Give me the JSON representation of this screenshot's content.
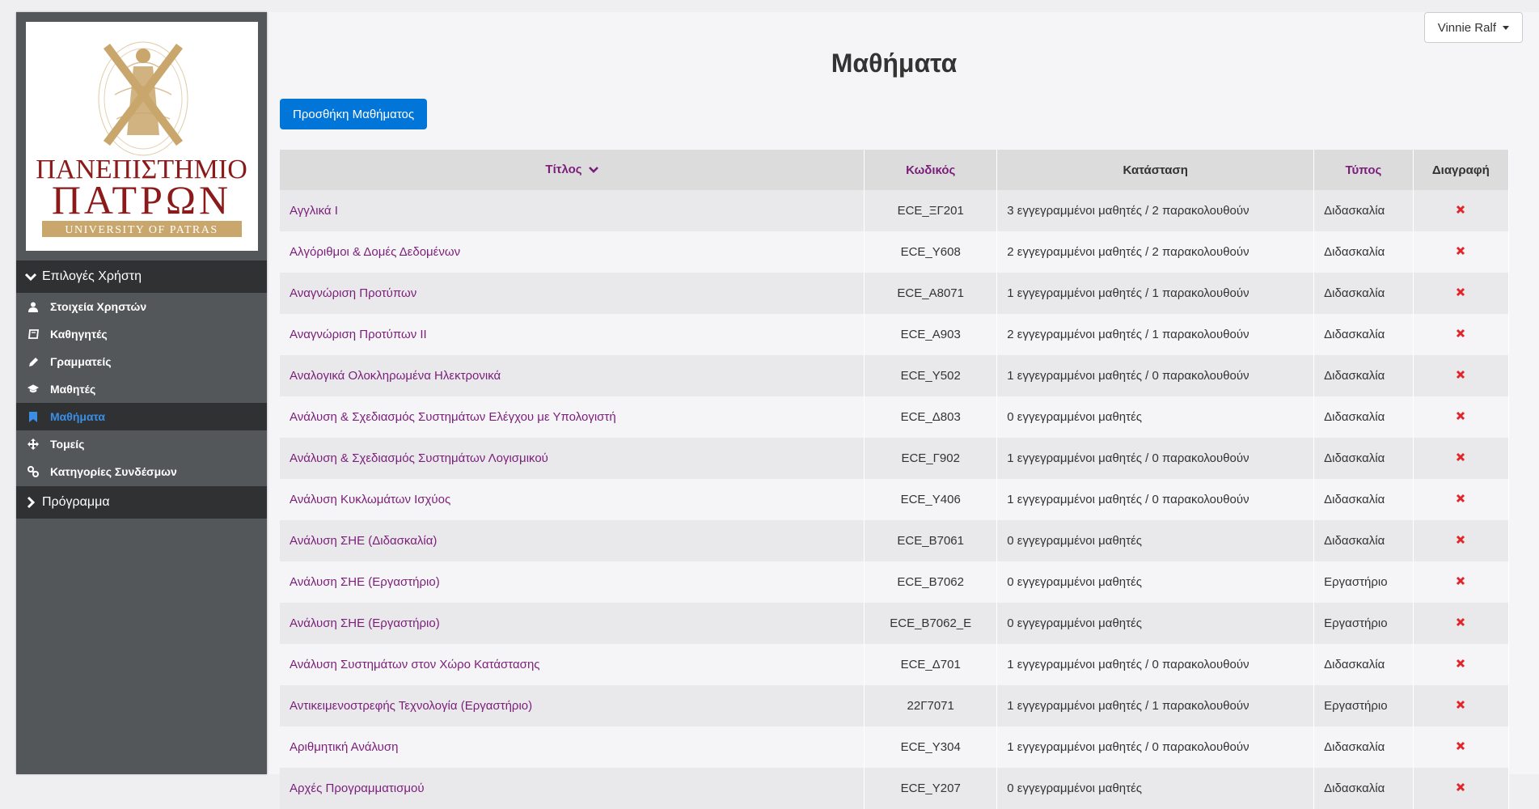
{
  "user": {
    "name": "Vinnie Ralf"
  },
  "logo": {
    "line1": "ΠΑΝΕΠΙΣΤΗΜΙΟ",
    "line2": "ΠΑΤΡΩΝ",
    "line3": "UNIVERSITY OF PATRAS",
    "brand_color": "#8b1a1a",
    "gold_color": "#c9a66b"
  },
  "sidebar": {
    "section1": "Επιλογές Χρήστη",
    "items": [
      {
        "label": "Στοιχεία Χρηστών",
        "icon": "user-icon"
      },
      {
        "label": "Καθηγητές",
        "icon": "book-icon"
      },
      {
        "label": "Γραμματείς",
        "icon": "pencil-icon"
      },
      {
        "label": "Μαθητές",
        "icon": "graduation-cap-icon"
      },
      {
        "label": "Μαθήματα",
        "icon": "bookmark-icon",
        "active": true
      },
      {
        "label": "Τομείς",
        "icon": "move-icon"
      },
      {
        "label": "Κατηγορίες Συνδέσμων",
        "icon": "link-icon"
      }
    ],
    "section2": "Πρόγραμμα"
  },
  "page": {
    "title": "Μαθήματα",
    "add_button": "Προσθήκη Μαθήματος"
  },
  "table": {
    "headers": {
      "title": "Τίτλος",
      "code": "Κωδικός",
      "status": "Κατάσταση",
      "type": "Τύπος",
      "delete": "Διαγραφή"
    },
    "rows": [
      {
        "title": "Αγγλικά Ι",
        "code": "ECE_ΞΓ201",
        "status": "3 εγγεγραμμένοι μαθητές / 2 παρακολουθούν",
        "type": "Διδασκαλία"
      },
      {
        "title": "Αλγόριθμοι & Δομές Δεδομένων",
        "code": "ECE_Υ608",
        "status": "2 εγγεγραμμένοι μαθητές / 2 παρακολουθούν",
        "type": "Διδασκαλία"
      },
      {
        "title": "Αναγνώριση Προτύπων",
        "code": "ECE_Α8071",
        "status": "1 εγγεγραμμένοι μαθητές / 1 παρακολουθούν",
        "type": "Διδασκαλία"
      },
      {
        "title": "Αναγνώριση Προτύπων ΙΙ",
        "code": "ECE_Α903",
        "status": "2 εγγεγραμμένοι μαθητές / 1 παρακολουθούν",
        "type": "Διδασκαλία"
      },
      {
        "title": "Αναλογικά Ολοκληρωμένα Ηλεκτρονικά",
        "code": "ECE_Υ502",
        "status": "1 εγγεγραμμένοι μαθητές / 0 παρακολουθούν",
        "type": "Διδασκαλία"
      },
      {
        "title": "Ανάλυση & Σχεδιασμός Συστημάτων Ελέγχου με Υπολογιστή",
        "code": "ECE_Δ803",
        "status": "0 εγγεγραμμένοι μαθητές",
        "type": "Διδασκαλία"
      },
      {
        "title": "Ανάλυση & Σχεδιασμός Συστημάτων Λογισμικού",
        "code": "ECE_Γ902",
        "status": "1 εγγεγραμμένοι μαθητές / 0 παρακολουθούν",
        "type": "Διδασκαλία"
      },
      {
        "title": "Ανάλυση Κυκλωμάτων Ισχύος",
        "code": "ECE_Υ406",
        "status": "1 εγγεγραμμένοι μαθητές / 0 παρακολουθούν",
        "type": "Διδασκαλία"
      },
      {
        "title": "Ανάλυση ΣΗΕ (Διδασκαλία)",
        "code": "ECE_Β7061",
        "status": "0 εγγεγραμμένοι μαθητές",
        "type": "Διδασκαλία"
      },
      {
        "title": "Ανάλυση ΣΗΕ (Εργαστήριο)",
        "code": "ECE_Β7062",
        "status": "0 εγγεγραμμένοι μαθητές",
        "type": "Εργαστήριο"
      },
      {
        "title": "Ανάλυση ΣΗΕ (Εργαστήριο)",
        "code": "ECE_Β7062_Ε",
        "status": "0 εγγεγραμμένοι μαθητές",
        "type": "Εργαστήριο"
      },
      {
        "title": "Ανάλυση Συστημάτων στον Χώρο Κατάστασης",
        "code": "ECE_Δ701",
        "status": "1 εγγεγραμμένοι μαθητές / 0 παρακολουθούν",
        "type": "Διδασκαλία"
      },
      {
        "title": "Αντικειμενοστρεφής Τεχνολογία (Εργαστήριο)",
        "code": "22Γ7071",
        "status": "1 εγγεγραμμένοι μαθητές / 1 παρακολουθούν",
        "type": "Εργαστήριο"
      },
      {
        "title": "Αριθμητική Ανάλυση",
        "code": "ECE_Υ304",
        "status": "1 εγγεγραμμένοι μαθητές / 0 παρακολουθούν",
        "type": "Διδασκαλία"
      },
      {
        "title": "Αρχές Προγραμματισμού",
        "code": "ECE_Υ207",
        "status": "0 εγγεγραμμένοι μαθητές",
        "type": "Διδασκαλία"
      }
    ]
  },
  "colors": {
    "accent_blue": "#0275d8",
    "link_purple": "#7b1e7a",
    "delete_red": "#e0262b",
    "active_nav": "#3a8ee6"
  }
}
